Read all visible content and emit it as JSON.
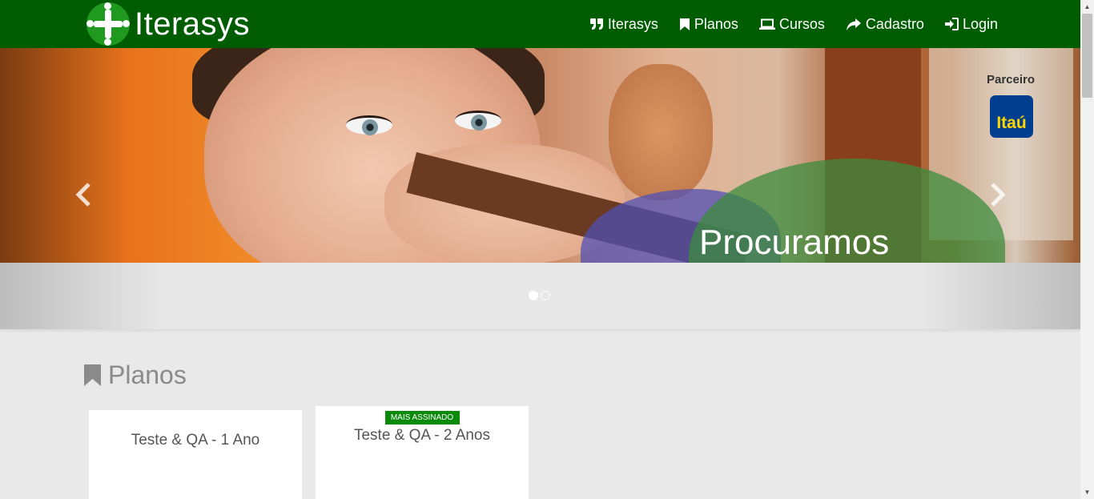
{
  "navbar": {
    "brand_name": "Iterasys",
    "background_color": "#005c00",
    "items": [
      {
        "label": "Iterasys",
        "icon": "quote-icon"
      },
      {
        "label": "Planos",
        "icon": "bookmark-icon"
      },
      {
        "label": "Cursos",
        "icon": "laptop-icon"
      },
      {
        "label": "Cadastro",
        "icon": "share-arrow-icon"
      },
      {
        "label": "Login",
        "icon": "login-icon"
      }
    ]
  },
  "carousel": {
    "caption": "Procuramos",
    "partner_label": "Parceiro",
    "partner_logo_text": "Itaú",
    "prev_icon": "chevron-left-icon",
    "next_icon": "chevron-right-icon",
    "indicators": [
      {
        "active": true
      },
      {
        "active": false
      }
    ]
  },
  "plans": {
    "title": "Planos",
    "title_icon": "bookmark-icon",
    "cards": [
      {
        "name": "Teste & QA - 1 Ano"
      },
      {
        "name": "Teste & QA - 2 Anos",
        "badge": "MAIS ASSINADO"
      }
    ]
  },
  "colors": {
    "accent_green": "#005c00",
    "badge_green": "#0a8a0a",
    "page_background": "#e9e9e9"
  }
}
